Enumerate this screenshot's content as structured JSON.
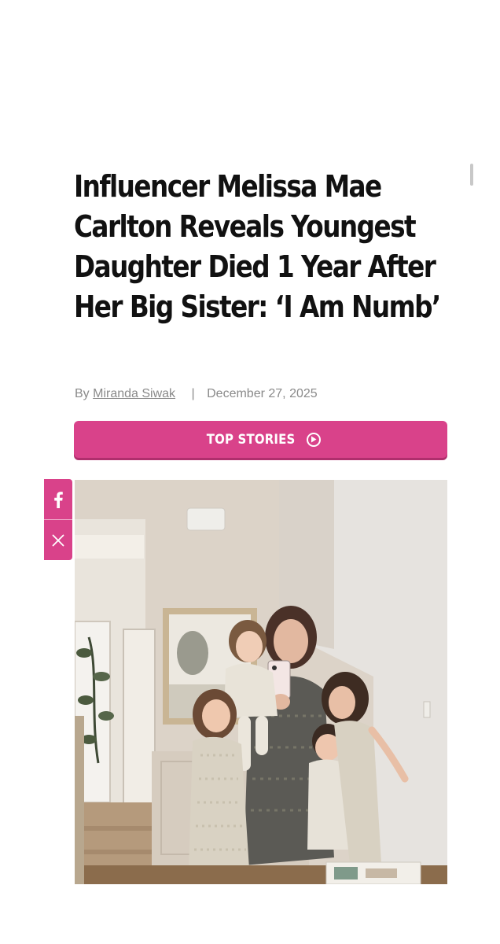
{
  "article": {
    "headline": "Influencer Melissa Mae Carlton Reveals Youngest Daughter Died 1 Year After Her Big Sister: ‘I Am Numb’",
    "byline_prefix": "By",
    "author": "Miranda Siwak",
    "separator": "|",
    "date": "December 27, 2025"
  },
  "top_stories": {
    "label": "TOP STORIES",
    "icon": "play-circle-icon"
  },
  "share": {
    "facebook_icon": "facebook-icon",
    "x_icon": "x-icon"
  },
  "photo": {
    "subject": "mirror selfie of mother with four children"
  },
  "colors": {
    "accent": "#d9428a",
    "headline": "#111111",
    "meta": "#8a8a8a"
  }
}
